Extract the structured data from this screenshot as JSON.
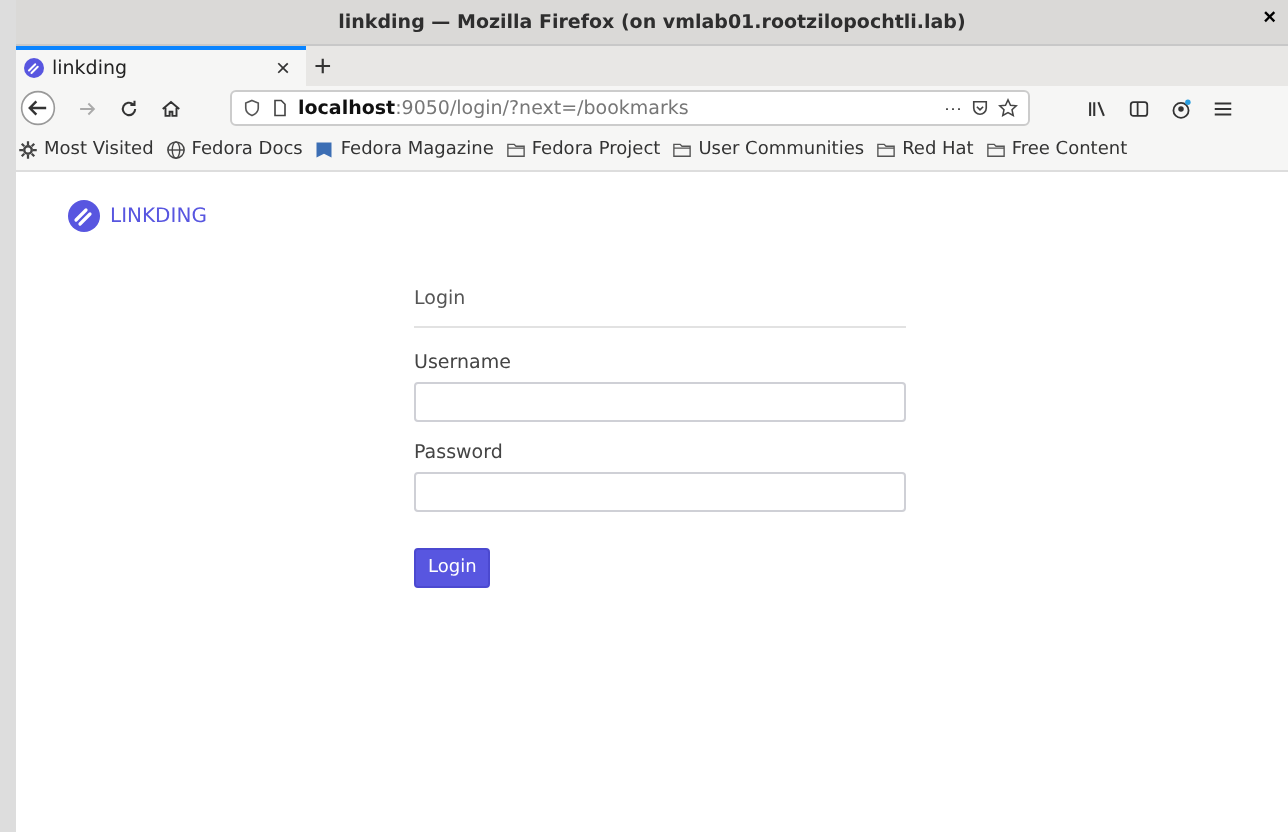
{
  "window": {
    "title": "linkding — Mozilla Firefox (on vmlab01.rootzilopochtli.lab)",
    "close": "×"
  },
  "tabs": [
    {
      "label": "linkding",
      "selected": true,
      "close": "×"
    }
  ],
  "new_tab": "+",
  "address_bar": {
    "host": "localhost",
    "path": ":9050/login/?next=/bookmarks",
    "more": "···"
  },
  "bookmarks": [
    {
      "kind": "gear",
      "label": "Most Visited"
    },
    {
      "kind": "globe",
      "label": "Fedora Docs"
    },
    {
      "kind": "flag",
      "label": "Fedora Magazine"
    },
    {
      "kind": "folder",
      "label": "Fedora Project"
    },
    {
      "kind": "folder",
      "label": "User Communities"
    },
    {
      "kind": "folder",
      "label": "Red Hat"
    },
    {
      "kind": "folder",
      "label": "Free Content"
    }
  ],
  "app": {
    "brand": "LINKDING"
  },
  "login_form": {
    "heading": "Login",
    "fields": [
      {
        "label": "Username"
      },
      {
        "label": "Password"
      }
    ],
    "submit": "Login"
  }
}
